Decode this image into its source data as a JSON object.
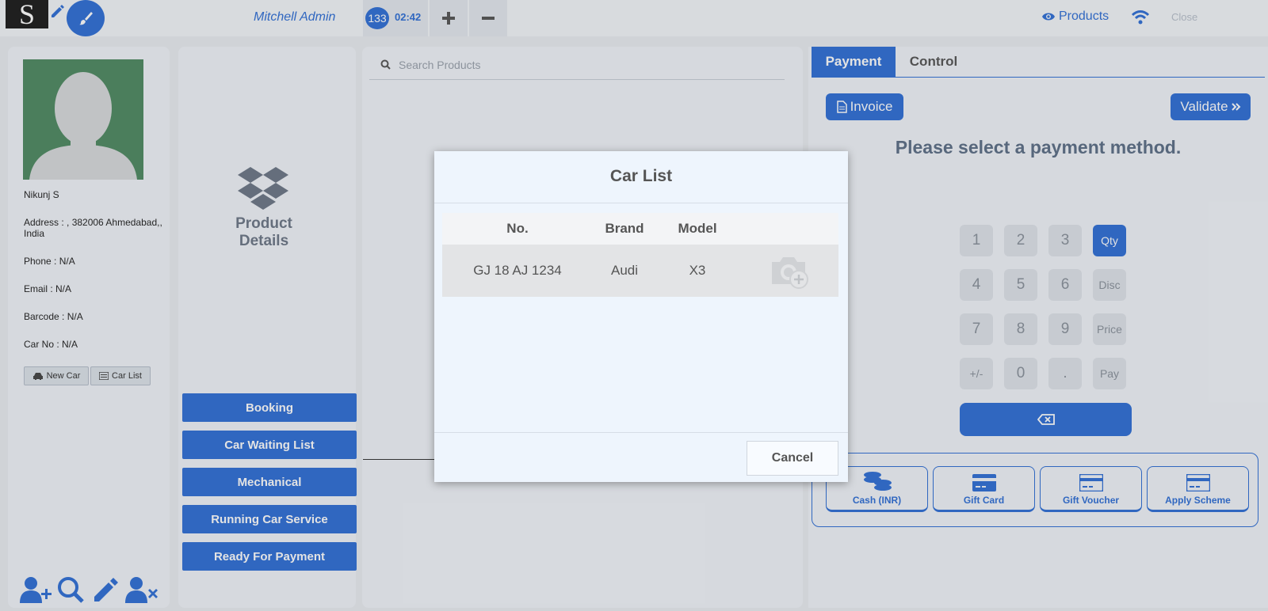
{
  "topbar": {
    "logo": "S",
    "user_name": "Mitchell Admin",
    "order_count": "133",
    "order_time": "02:42",
    "products_label": "Products",
    "close_label": "Close"
  },
  "customer": {
    "name": "Nikunj S",
    "address": "Address : , 382006 Ahmedabad,, India",
    "phone": "Phone : N/A",
    "email": "Email : N/A",
    "barcode": "Barcode : N/A",
    "car_no": "Car No : N/A",
    "new_car_label": "New Car",
    "car_list_label": "Car List"
  },
  "product_details": {
    "label_line1": "Product",
    "label_line2": "Details"
  },
  "side_buttons": [
    "Booking",
    "Car Waiting List",
    "Mechanical",
    "Running Car Service",
    "Ready For Payment"
  ],
  "search": {
    "placeholder": "Search Products"
  },
  "payment": {
    "tabs": [
      "Payment",
      "Control"
    ],
    "invoice_label": "Invoice",
    "validate_label": "Validate",
    "message": "Please select a payment method.",
    "keypad": [
      [
        "1",
        "2",
        "3",
        "Qty"
      ],
      [
        "4",
        "5",
        "6",
        "Disc"
      ],
      [
        "7",
        "8",
        "9",
        "Price"
      ],
      [
        "+/-",
        "0",
        ".",
        "Pay"
      ]
    ],
    "methods": [
      "Cash (INR)",
      "Gift Card",
      "Gift Voucher",
      "Apply Scheme"
    ]
  },
  "modal": {
    "title": "Car List",
    "columns": [
      "No.",
      "Brand",
      "Model"
    ],
    "rows": [
      {
        "no": "GJ 18 AJ 1234",
        "brand": "Audi",
        "model": "X3"
      }
    ],
    "cancel_label": "Cancel"
  },
  "colors": {
    "accent": "#2f6fd7",
    "panel": "#f0f4fa"
  }
}
